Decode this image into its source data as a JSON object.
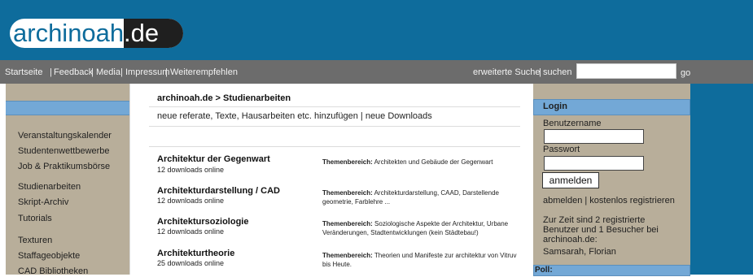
{
  "logo": {
    "name": "archinoah",
    "tld": ".de"
  },
  "nav": {
    "links": [
      "Startseite",
      "Feedback",
      "Media",
      "Impressum",
      "Weiterempfehlen"
    ],
    "search_links": [
      "erweiterte Suche",
      "suchen"
    ],
    "search_value": "",
    "go_label": "go"
  },
  "left_nav": {
    "items": [
      "Veranstaltungskalender",
      "Studentenwettbewerbe",
      "Job & Praktikumsbörse",
      "Studienarbeiten",
      "Skript-Archiv",
      "Tutorials",
      "Texturen",
      "Staffageobjekte",
      "CAD Bibliotheken"
    ]
  },
  "main": {
    "breadcrumb": "archinoah.de > Studienarbeiten",
    "actions": "neue referate, Texte, Hausarbeiten etc. hinzufügen | neue Downloads",
    "theme_label": "Themenbereich:",
    "categories": [
      {
        "title": "Architektur der Gegenwart",
        "downloads": "12 downloads online",
        "desc": "Architekten und Gebäude der Gegenwart"
      },
      {
        "title": "Architekturdarstellung / CAD",
        "downloads": "12 downloads online",
        "desc": "Architekturdarstellung, CAAD, Darstellende geometrie, Farblehre ..."
      },
      {
        "title": "Architektursoziologie",
        "downloads": "12 downloads online",
        "desc": "Soziologische Aspekte der Architektur, Urbane Veränderungen, Stadtentwicklungen (kein Städtebau!)"
      },
      {
        "title": "Architekturtheorie",
        "downloads": "25 downloads online",
        "desc": "Theorien und Manifeste zur architektur von Vitruv bis Heute."
      }
    ]
  },
  "login": {
    "title": "Login",
    "username_label": "Benutzername",
    "password_label": "Passwort",
    "username_value": "",
    "password_value": "",
    "submit": "anmelden",
    "links": "abmelden | kostenlos registrieren",
    "online_text": "Zur Zeit sind 2 registrierte Benutzer und 1 Besucher bei archinoah.de:",
    "online_users": "Samsarah, Florian"
  },
  "poll": {
    "title": "Poll:"
  }
}
